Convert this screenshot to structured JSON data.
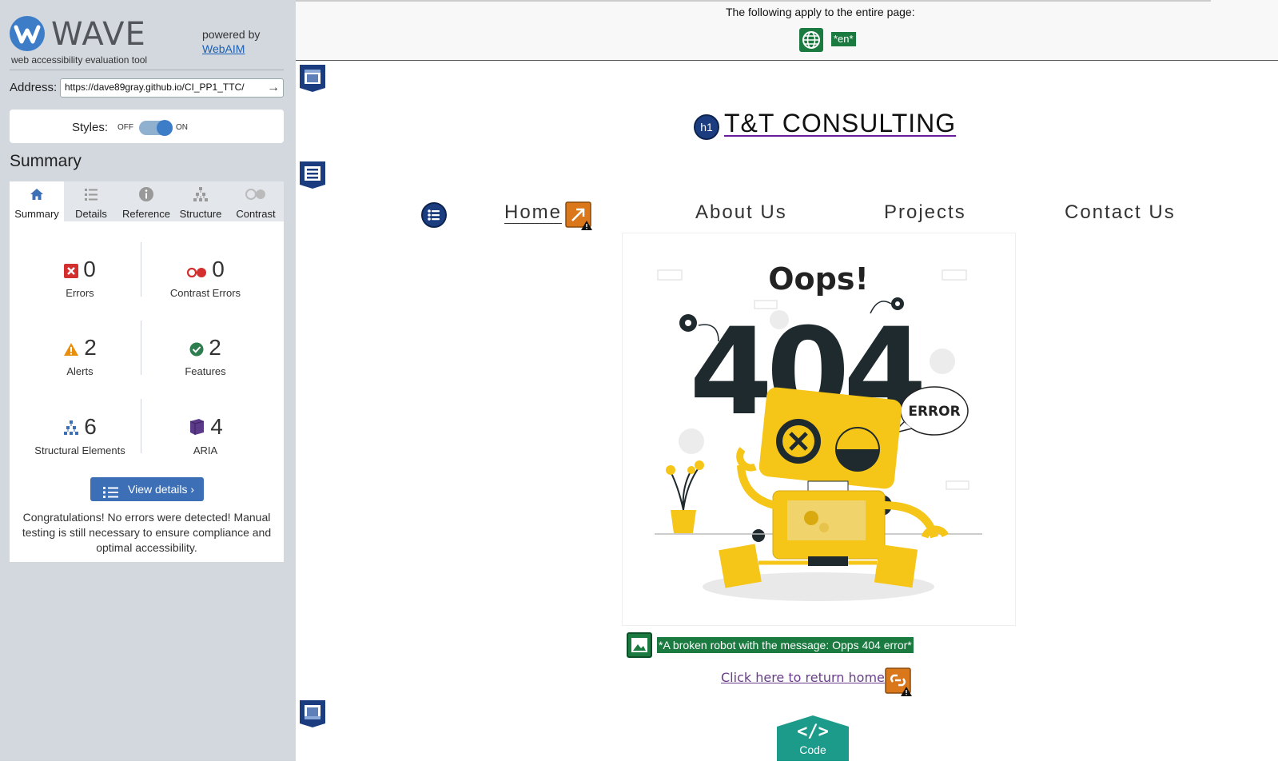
{
  "sidebar": {
    "logo_word": "WAVE",
    "logo_sub": "web accessibility evaluation tool",
    "powered_by": "powered by",
    "webaim_link": "WebAIM",
    "address_label": "Address:",
    "address_value": "https://dave89gray.github.io/CI_PP1_TTC/",
    "styles_label": "Styles:",
    "styles_off": "OFF",
    "styles_on": "ON",
    "summary_heading": "Summary",
    "tabs": [
      {
        "label": "Summary",
        "icon": "home-icon",
        "active": true
      },
      {
        "label": "Details",
        "icon": "list-icon"
      },
      {
        "label": "Reference",
        "icon": "info-icon"
      },
      {
        "label": "Structure",
        "icon": "structure-icon"
      },
      {
        "label": "Contrast",
        "icon": "contrast-icon"
      }
    ],
    "stats": {
      "errors": {
        "count": "0",
        "label": "Errors",
        "color": "#d32f2f"
      },
      "contrast_errors": {
        "count": "0",
        "label": "Contrast Errors",
        "color": "#d32f2f"
      },
      "alerts": {
        "count": "2",
        "label": "Alerts",
        "color": "#e8900c"
      },
      "features": {
        "count": "2",
        "label": "Features",
        "color": "#2e7d4f"
      },
      "structural": {
        "count": "6",
        "label": "Structural Elements",
        "color": "#3d6fb6"
      },
      "aria": {
        "count": "4",
        "label": "ARIA",
        "color": "#5b3a8a"
      }
    },
    "view_details": "View details ›",
    "congrats": "Congratulations! No errors were detected! Manual testing is still necessary to ensure compliance and optimal accessibility."
  },
  "page": {
    "apply_text": "The following apply to the entire page:",
    "lang_tag": "*en*",
    "h1_badge": "h1",
    "site_title": "T&T CONSULTING",
    "nav": [
      "Home",
      "About Us",
      "Projects",
      "Contact Us"
    ],
    "oops_title": "Oops!",
    "error_code": "404",
    "error_bubble": "ERROR",
    "alt_text": "*A broken robot with the message: Opps 404 error*",
    "return_link": "Click here to return home",
    "code_tab": "Code"
  },
  "colors": {
    "accent": "#3d7dc8",
    "feature_green": "#1a7a3f",
    "alert_orange": "#d9771a",
    "structure_navy": "#1b3d80",
    "robot_yellow": "#f5c518"
  }
}
